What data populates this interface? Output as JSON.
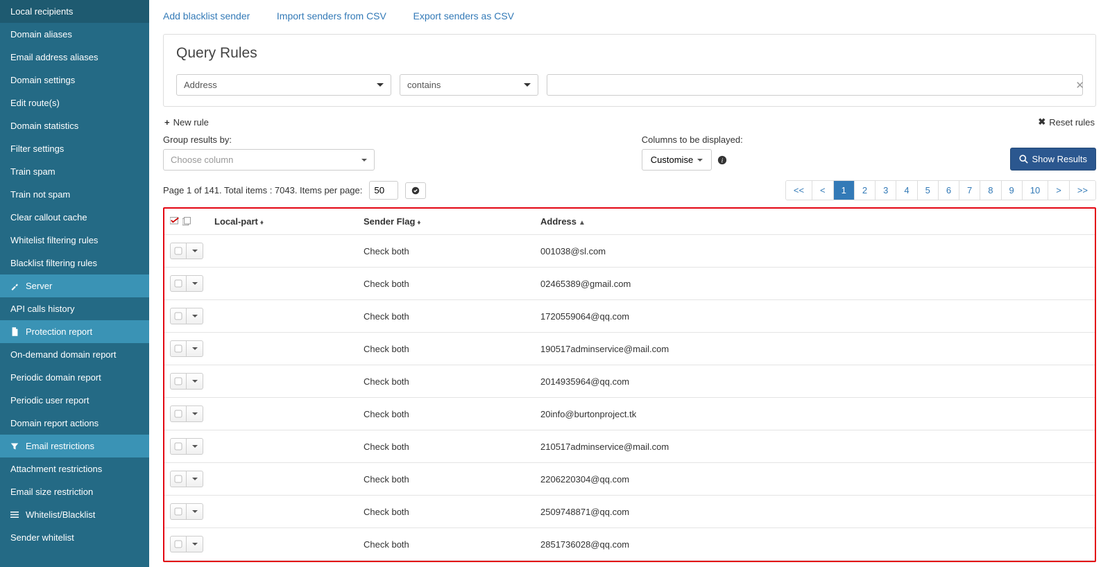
{
  "sidebar": {
    "items": [
      {
        "label": "Local recipients",
        "icon": "",
        "active": false
      },
      {
        "label": "Domain aliases",
        "icon": "",
        "active": false
      },
      {
        "label": "Email address aliases",
        "icon": "",
        "active": false
      },
      {
        "label": "Domain settings",
        "icon": "",
        "active": false
      },
      {
        "label": "Edit route(s)",
        "icon": "",
        "active": false
      },
      {
        "label": "Domain statistics",
        "icon": "",
        "active": false
      },
      {
        "label": "Filter settings",
        "icon": "",
        "active": false
      },
      {
        "label": "Train spam",
        "icon": "",
        "active": false
      },
      {
        "label": "Train not spam",
        "icon": "",
        "active": false
      },
      {
        "label": "Clear callout cache",
        "icon": "",
        "active": false
      },
      {
        "label": "Whitelist filtering rules",
        "icon": "",
        "active": false
      },
      {
        "label": "Blacklist filtering rules",
        "icon": "",
        "active": false
      },
      {
        "label": "Server",
        "icon": "wrench",
        "active": true
      },
      {
        "label": "API calls history",
        "icon": "",
        "active": false
      },
      {
        "label": "Protection report",
        "icon": "file",
        "active": true
      },
      {
        "label": "On-demand domain report",
        "icon": "",
        "active": false
      },
      {
        "label": "Periodic domain report",
        "icon": "",
        "active": false
      },
      {
        "label": "Periodic user report",
        "icon": "",
        "active": false
      },
      {
        "label": "Domain report actions",
        "icon": "",
        "active": false
      },
      {
        "label": "Email restrictions",
        "icon": "filter",
        "active": true
      },
      {
        "label": "Attachment restrictions",
        "icon": "",
        "active": false
      },
      {
        "label": "Email size restriction",
        "icon": "",
        "active": false
      },
      {
        "label": "Whitelist/Blacklist",
        "icon": "list",
        "active": false
      },
      {
        "label": "Sender whitelist",
        "icon": "",
        "active": false
      }
    ]
  },
  "actions": {
    "add_sender": "Add blacklist sender",
    "import_csv": "Import senders from CSV",
    "export_csv": "Export senders as CSV"
  },
  "query": {
    "title": "Query Rules",
    "field": "Address",
    "operator": "contains",
    "value": "",
    "new_rule": "New rule",
    "reset_rules": "Reset rules"
  },
  "controls": {
    "group_label": "Group results by:",
    "group_placeholder": "Choose column",
    "columns_label": "Columns to be displayed:",
    "customise_label": "Customise",
    "show_results": "Show Results"
  },
  "paging": {
    "info_prefix": "Page 1 of 141. Total items : 7043. Items per page:",
    "items_per_page": "50",
    "pages": [
      "<<",
      "<",
      "1",
      "2",
      "3",
      "4",
      "5",
      "6",
      "7",
      "8",
      "9",
      "10",
      ">",
      ">>"
    ],
    "active_page": "1"
  },
  "table": {
    "col_local": "Local-part",
    "col_flag": "Sender Flag",
    "col_address": "Address",
    "rows": [
      {
        "local": "",
        "flag": "Check both",
        "address": "001038@sl.com"
      },
      {
        "local": "",
        "flag": "Check both",
        "address": "02465389@gmail.com"
      },
      {
        "local": "",
        "flag": "Check both",
        "address": "1720559064@qq.com"
      },
      {
        "local": "",
        "flag": "Check both",
        "address": "190517adminservice@mail.com"
      },
      {
        "local": "",
        "flag": "Check both",
        "address": "2014935964@qq.com"
      },
      {
        "local": "",
        "flag": "Check both",
        "address": "20info@burtonproject.tk"
      },
      {
        "local": "",
        "flag": "Check both",
        "address": "210517adminservice@mail.com"
      },
      {
        "local": "",
        "flag": "Check both",
        "address": "2206220304@qq.com"
      },
      {
        "local": "",
        "flag": "Check both",
        "address": "2509748871@qq.com"
      },
      {
        "local": "",
        "flag": "Check both",
        "address": "2851736028@qq.com"
      }
    ]
  }
}
